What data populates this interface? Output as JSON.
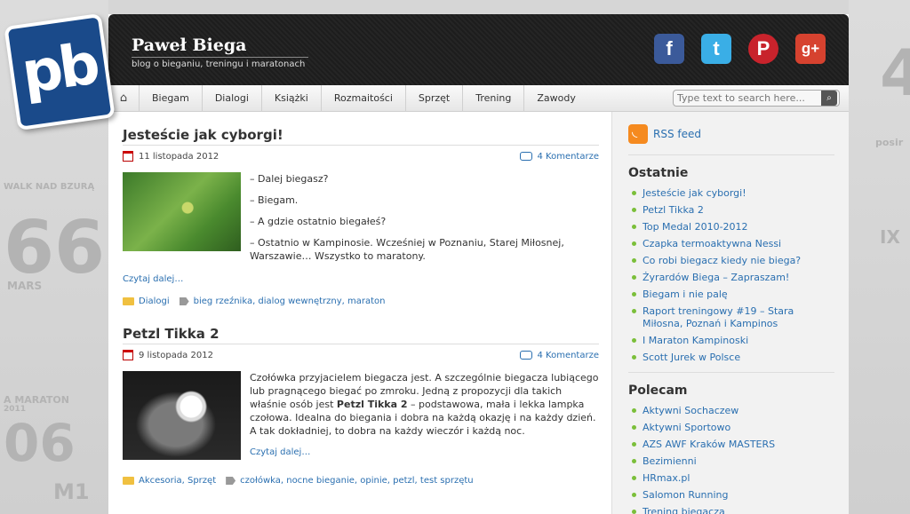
{
  "logo": {
    "text": "pb"
  },
  "header": {
    "title": "Paweł Biega",
    "tagline": "blog o bieganiu, treningu i maratonach",
    "social": [
      {
        "name": "facebook-icon",
        "glyph": "f"
      },
      {
        "name": "twitter-icon",
        "glyph": "t"
      },
      {
        "name": "pinterest-icon",
        "glyph": "P"
      },
      {
        "name": "google-plus-icon",
        "glyph": "g+"
      }
    ]
  },
  "nav": {
    "items": [
      "Biegam",
      "Dialogi",
      "Książki",
      "Rozmaitości",
      "Sprzęt",
      "Trening",
      "Zawody"
    ],
    "search_placeholder": "Type text to search here..."
  },
  "posts": [
    {
      "title": "Jesteście jak cyborgi!",
      "date": "11 listopada 2012",
      "comments": "4 Komentarze",
      "paragraphs": [
        "– Dalej biegasz?",
        "– Biegam.",
        "– A gdzie ostatnio biegałeś?",
        "– Ostatnio w Kampinosie. Wcześniej w Poznaniu, Starej Miłosnej, Warszawie… Wszystko to maratony."
      ],
      "read_more": "Czytaj dalej…",
      "category": "Dialogi",
      "tags": "bieg rzeźnika, dialog wewnętrzny, maraton"
    },
    {
      "title": "Petzl Tikka 2",
      "date": "9 listopada 2012",
      "comments": "4 Komentarze",
      "text_before": "Czołówka przyjacielem biegacza jest. A szczególnie biegacza lubiącego lub pragnącego biegać po zmroku. Jedną z propozycji dla takich właśnie osób jest ",
      "text_bold": "Petzl Tikka 2",
      "text_after": " – podstawowa, mała i lekka lampka czołowa. Idealna do biegania i dobra na każdą okazję i na każdy dzień. A tak dokładniej, to dobra na każdy wieczór i każdą noc.",
      "read_more": "Czytaj dalej…",
      "category": "Akcesoria, Sprzęt",
      "tags": "czołówka, nocne bieganie, opinie, petzl, test sprzętu"
    }
  ],
  "sidebar": {
    "rss": "RSS feed",
    "recent_heading": "Ostatnie",
    "recent": [
      "Jesteście jak cyborgi!",
      "Petzl Tikka 2",
      "Top Medal 2010-2012",
      "Czapka termoaktywna Nessi",
      "Co robi biegacz kiedy nie biega?",
      "Żyrardów Biega – Zapraszam!",
      "Biegam i nie palę",
      "Raport treningowy #19 – Stara Miłosna, Poznań i Kampinos",
      "I Maraton Kampinoski",
      "Scott Jurek w Polsce"
    ],
    "recommend_heading": "Polecam",
    "recommend": [
      "Aktywni Sochaczew",
      "Aktywni Sportowo",
      "AZS AWF Kraków MASTERS",
      "Bezimienni",
      "HRmax.pl",
      "Salomon Running",
      "Trening biegacza"
    ]
  },
  "background_decor": [
    "WALK NAD BZURĄ",
    "66",
    "MARS",
    "A MARATON",
    "2011",
    "06",
    "M1",
    "4",
    "posir",
    "IX"
  ]
}
